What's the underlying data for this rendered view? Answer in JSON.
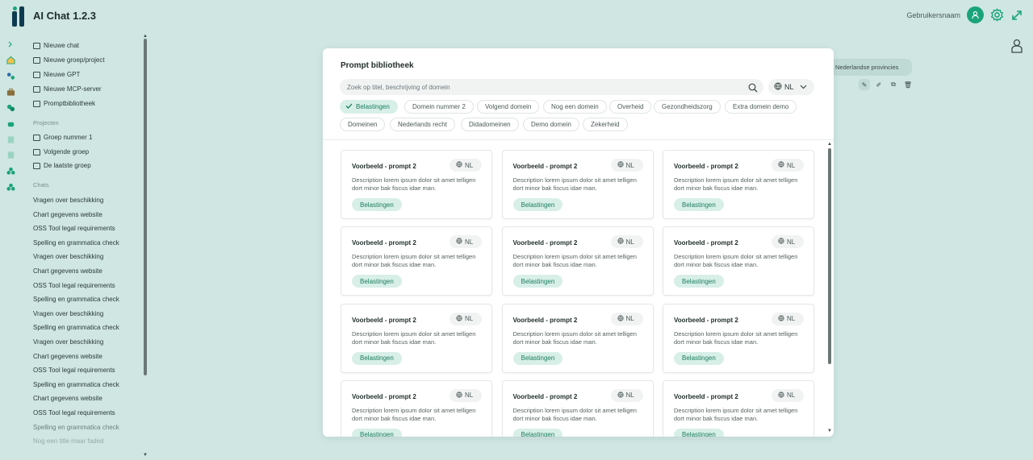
{
  "app": {
    "title": "AI Chat 1.2.3",
    "username": "Gebruikersnaam"
  },
  "colors": {
    "accent": "#1aa37a",
    "background": "#cfe6e2",
    "chip_selected": "#d8efe8",
    "logo": "#0f3b50"
  },
  "sidebar": {
    "actions": [
      {
        "label": "Nieuwe chat",
        "icon": "edit-icon"
      },
      {
        "label": "Nieuwe groep/project",
        "icon": "folder-plus-icon"
      },
      {
        "label": "Nieuwe GPT",
        "icon": "gpt-icon"
      },
      {
        "label": "Nieuwe MCP-server",
        "icon": "server-icon"
      },
      {
        "label": "Promptbibliotheek",
        "icon": "book-icon"
      }
    ],
    "projects_heading": "Projecten",
    "projects": [
      "Groep nummer 1",
      "Volgende groep",
      "De laatste groep"
    ],
    "chats_heading": "Chats",
    "chats": [
      "Vragen over beschikking",
      "Chart gegevens website",
      "OSS Tool legal requirements",
      "Spelling en grammatica check",
      "Vragen over beschikking",
      "Chart gegevens website",
      "OSS Tool legal requirements",
      "Spelling en grammatica check",
      "Vragen over beschikking",
      "Spelling en grammatica check",
      "Vragen over beschikking",
      "Chart gegevens website",
      "OSS Tool legal requirements",
      "Spelling en grammatica check",
      "Chart gegevens website",
      "OSS Tool legal requirements",
      "Spelling en grammatica check",
      "Nog een title maar faded"
    ]
  },
  "workspace": {
    "tag_label": "Nederlandse provincies"
  },
  "modal": {
    "title": "Prompt bibliotheek",
    "search_placeholder": "Zoek op titel, beschrijving of domein",
    "language": "NL",
    "chips": [
      {
        "label": "Belastingen",
        "selected": true
      },
      {
        "label": "Domein nummer 2",
        "selected": false
      },
      {
        "label": "Volgend domein",
        "selected": false
      },
      {
        "label": "Nog een domein",
        "selected": false
      },
      {
        "label": "Overheid",
        "selected": false
      },
      {
        "label": "Gezondheidszorg",
        "selected": false
      },
      {
        "label": "Extra domein demo",
        "selected": false
      },
      {
        "label": "Domeinen",
        "selected": false
      },
      {
        "label": "Nederlands recht",
        "selected": false
      },
      {
        "label": "Didadomeinen",
        "selected": false
      },
      {
        "label": "Demo domein",
        "selected": false
      },
      {
        "label": "Zekerheid",
        "selected": false
      }
    ],
    "cards": [
      {
        "title": "Voorbeeld - prompt 2",
        "lang": "NL",
        "description": "Description lorem ipsum dolor sit amet telligen dort minor bak fiscus idae man.",
        "tag": "Belastingen"
      },
      {
        "title": "Voorbeeld - prompt 2",
        "lang": "NL",
        "description": "Description lorem ipsum dolor sit amet telligen dort minor bak fiscus idae man.",
        "tag": "Belastingen"
      },
      {
        "title": "Voorbeeld - prompt 2",
        "lang": "NL",
        "description": "Description lorem ipsum dolor sit amet telligen dort minor bak fiscus idae man.",
        "tag": "Belastingen"
      },
      {
        "title": "Voorbeeld - prompt 2",
        "lang": "NL",
        "description": "Description lorem ipsum dolor sit amet telligen dort minor bak fiscus idae man.",
        "tag": "Belastingen"
      },
      {
        "title": "Voorbeeld - prompt 2",
        "lang": "NL",
        "description": "Description lorem ipsum dolor sit amet telligen dort minor bak fiscus idae man.",
        "tag": "Belastingen"
      },
      {
        "title": "Voorbeeld - prompt 2",
        "lang": "NL",
        "description": "Description lorem ipsum dolor sit amet telligen dort minor bak fiscus idae man.",
        "tag": "Belastingen"
      },
      {
        "title": "Voorbeeld - prompt 2",
        "lang": "NL",
        "description": "Description lorem ipsum dolor sit amet telligen dort minor bak fiscus idae man.",
        "tag": "Belastingen"
      },
      {
        "title": "Voorbeeld - prompt 2",
        "lang": "NL",
        "description": "Description lorem ipsum dolor sit amet telligen dort minor bak fiscus idae man.",
        "tag": "Belastingen"
      },
      {
        "title": "Voorbeeld - prompt 2",
        "lang": "NL",
        "description": "Description lorem ipsum dolor sit amet telligen dort minor bak fiscus idae man.",
        "tag": "Belastingen"
      },
      {
        "title": "Voorbeeld - prompt 2",
        "lang": "NL",
        "description": "Description lorem ipsum dolor sit amet telligen dort minor bak fiscus idae man.",
        "tag": "Belastingen"
      },
      {
        "title": "Voorbeeld - prompt 2",
        "lang": "NL",
        "description": "Description lorem ipsum dolor sit amet telligen dort minor bak fiscus idae man.",
        "tag": "Belastingen"
      },
      {
        "title": "Voorbeeld - prompt 2",
        "lang": "NL",
        "description": "Description lorem ipsum dolor sit amet telligen dort minor bak fiscus idae man.",
        "tag": "Belastingen"
      }
    ]
  }
}
